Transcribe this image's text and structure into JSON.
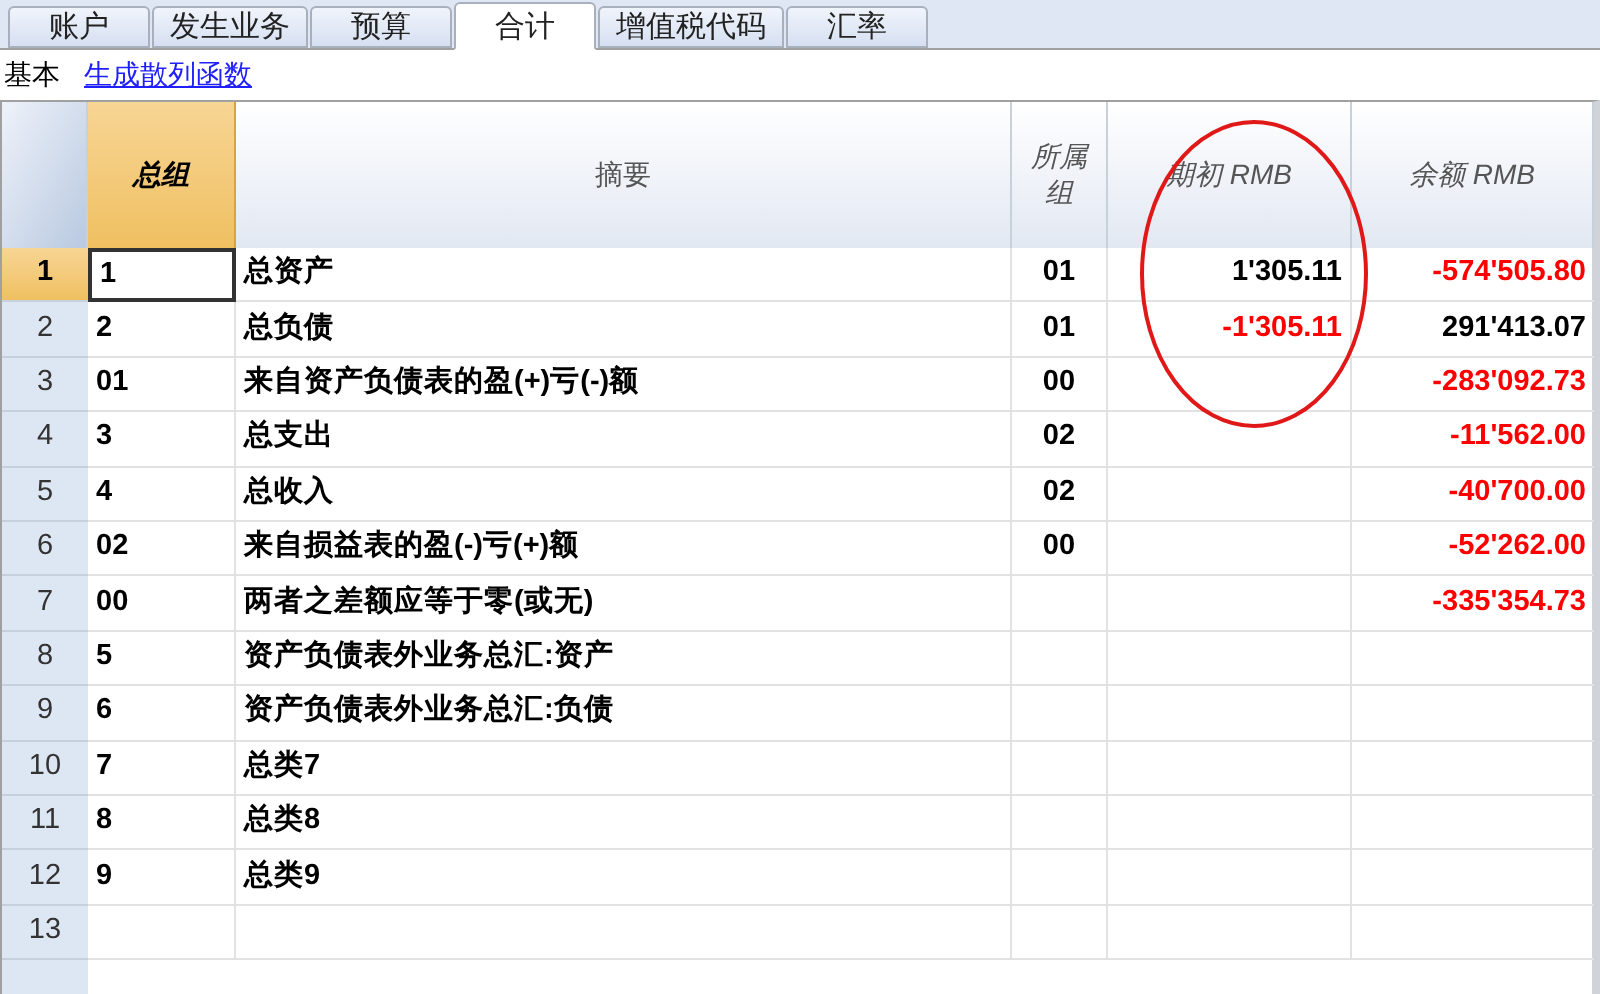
{
  "tabs": [
    {
      "label": "账户",
      "selected": false
    },
    {
      "label": "发生业务",
      "selected": false
    },
    {
      "label": "预算",
      "selected": false
    },
    {
      "label": "合计",
      "selected": true
    },
    {
      "label": "增值税代码",
      "selected": false
    },
    {
      "label": "汇率",
      "selected": false
    }
  ],
  "view_label": "基本",
  "view_link": "生成散列函数",
  "columns": [
    {
      "label": "总组",
      "selected": true,
      "italic": true
    },
    {
      "label": "摘要",
      "selected": false,
      "italic": false
    },
    {
      "label": "所属组",
      "selected": false,
      "italic": true
    },
    {
      "label": "期初 RMB",
      "selected": false,
      "italic": true
    },
    {
      "label": "余额 RMB",
      "selected": false,
      "italic": true
    }
  ],
  "rows": [
    {
      "number": "1",
      "selected": true,
      "group": "1",
      "description": "总资产",
      "parent": "01",
      "opening": {
        "text": "1'305.11",
        "negative": false
      },
      "balance": {
        "text": "-574'505.80",
        "negative": true
      }
    },
    {
      "number": "2",
      "selected": false,
      "group": "2",
      "description": "总负债",
      "parent": "01",
      "opening": {
        "text": "-1'305.11",
        "negative": true
      },
      "balance": {
        "text": "291'413.07",
        "negative": false
      }
    },
    {
      "number": "3",
      "selected": false,
      "group": "01",
      "description": "来自资产负债表的盈(+)亏(-)额",
      "parent": "00",
      "balance": {
        "text": "-283'092.73",
        "negative": true
      }
    },
    {
      "number": "4",
      "selected": false,
      "group": "3",
      "description": "总支出",
      "parent": "02",
      "balance": {
        "text": "-11'562.00",
        "negative": true
      }
    },
    {
      "number": "5",
      "selected": false,
      "group": "4",
      "description": "总收入",
      "parent": "02",
      "balance": {
        "text": "-40'700.00",
        "negative": true
      }
    },
    {
      "number": "6",
      "selected": false,
      "group": "02",
      "description": "来自损益表的盈(-)亏(+)额",
      "parent": "00",
      "balance": {
        "text": "-52'262.00",
        "negative": true
      }
    },
    {
      "number": "7",
      "selected": false,
      "group": "00",
      "description": "两者之差额应等于零(或无)",
      "balance": {
        "text": "-335'354.73",
        "negative": true
      }
    },
    {
      "number": "8",
      "selected": false,
      "group": "5",
      "description": "资产负债表外业务总汇:资产"
    },
    {
      "number": "9",
      "selected": false,
      "group": "6",
      "description": "资产负债表外业务总汇:负债"
    },
    {
      "number": "10",
      "selected": false,
      "group": "7",
      "description": "总类7"
    },
    {
      "number": "11",
      "selected": false,
      "group": "8",
      "description": "总类8"
    },
    {
      "number": "12",
      "selected": false,
      "group": "9",
      "description": "总类9"
    },
    {
      "number": "13",
      "selected": false
    }
  ],
  "annotation": {
    "kind": "ellipse"
  }
}
